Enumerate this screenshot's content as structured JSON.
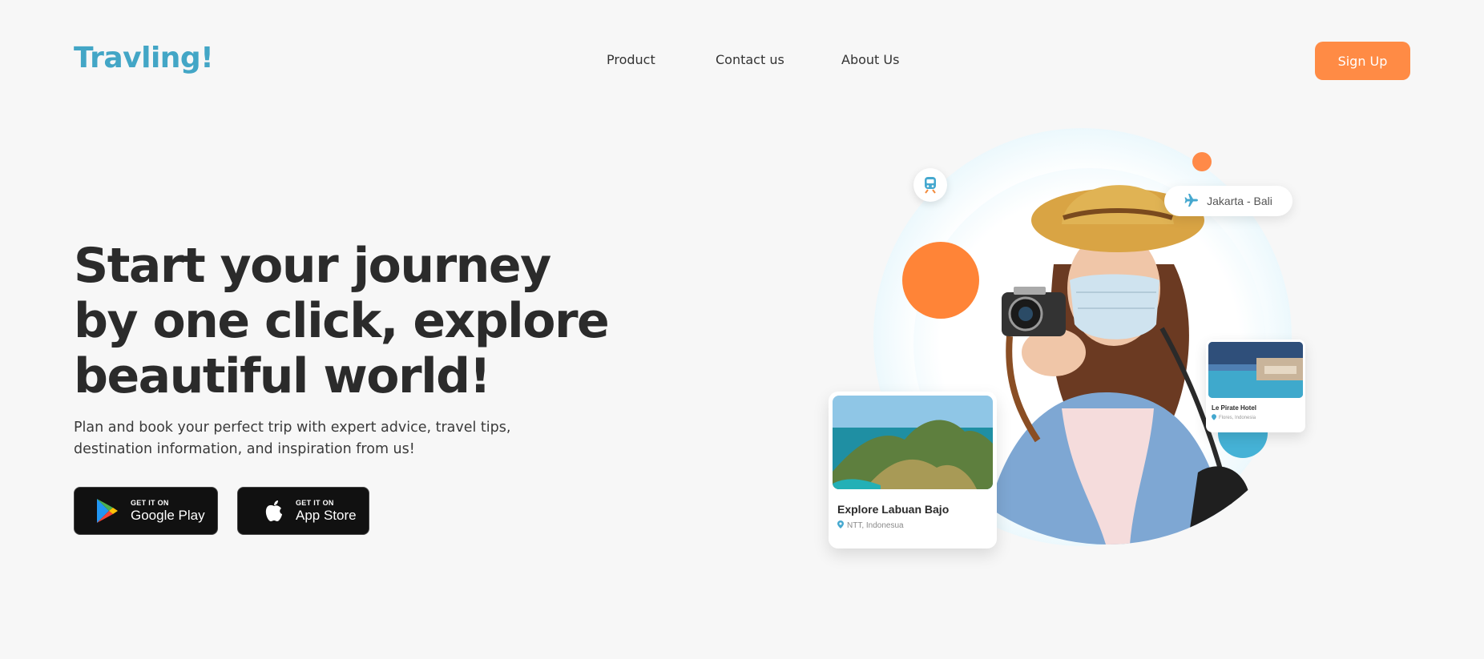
{
  "header": {
    "logo": "Travling!",
    "nav": [
      "Product",
      "Contact us",
      "About Us"
    ],
    "signup_label": "Sign Up"
  },
  "hero": {
    "title_lines": [
      "Start your journey",
      "by one click, explore",
      "beautiful world!"
    ],
    "subtitle_lines": [
      "Plan and book your perfect trip with expert advice, travel tips,",
      "destination information, and inspiration from us!"
    ],
    "stores": [
      {
        "small": "GET IT ON",
        "big": "Google Play",
        "icon": "google-play-icon"
      },
      {
        "small": "GET IT ON",
        "big": "App Store",
        "icon": "apple-icon"
      }
    ]
  },
  "illustration": {
    "route": "Jakarta - Bali",
    "card_big": {
      "title": "Explore Labuan Bajo",
      "location": "NTT, Indonesua"
    },
    "card_small": {
      "title": "Le Pirate Hotel",
      "location": "Flores, Indonesia"
    }
  },
  "colors": {
    "accent": "#ff8b45",
    "brand": "#43a6c6",
    "background": "#f7f7f7"
  }
}
